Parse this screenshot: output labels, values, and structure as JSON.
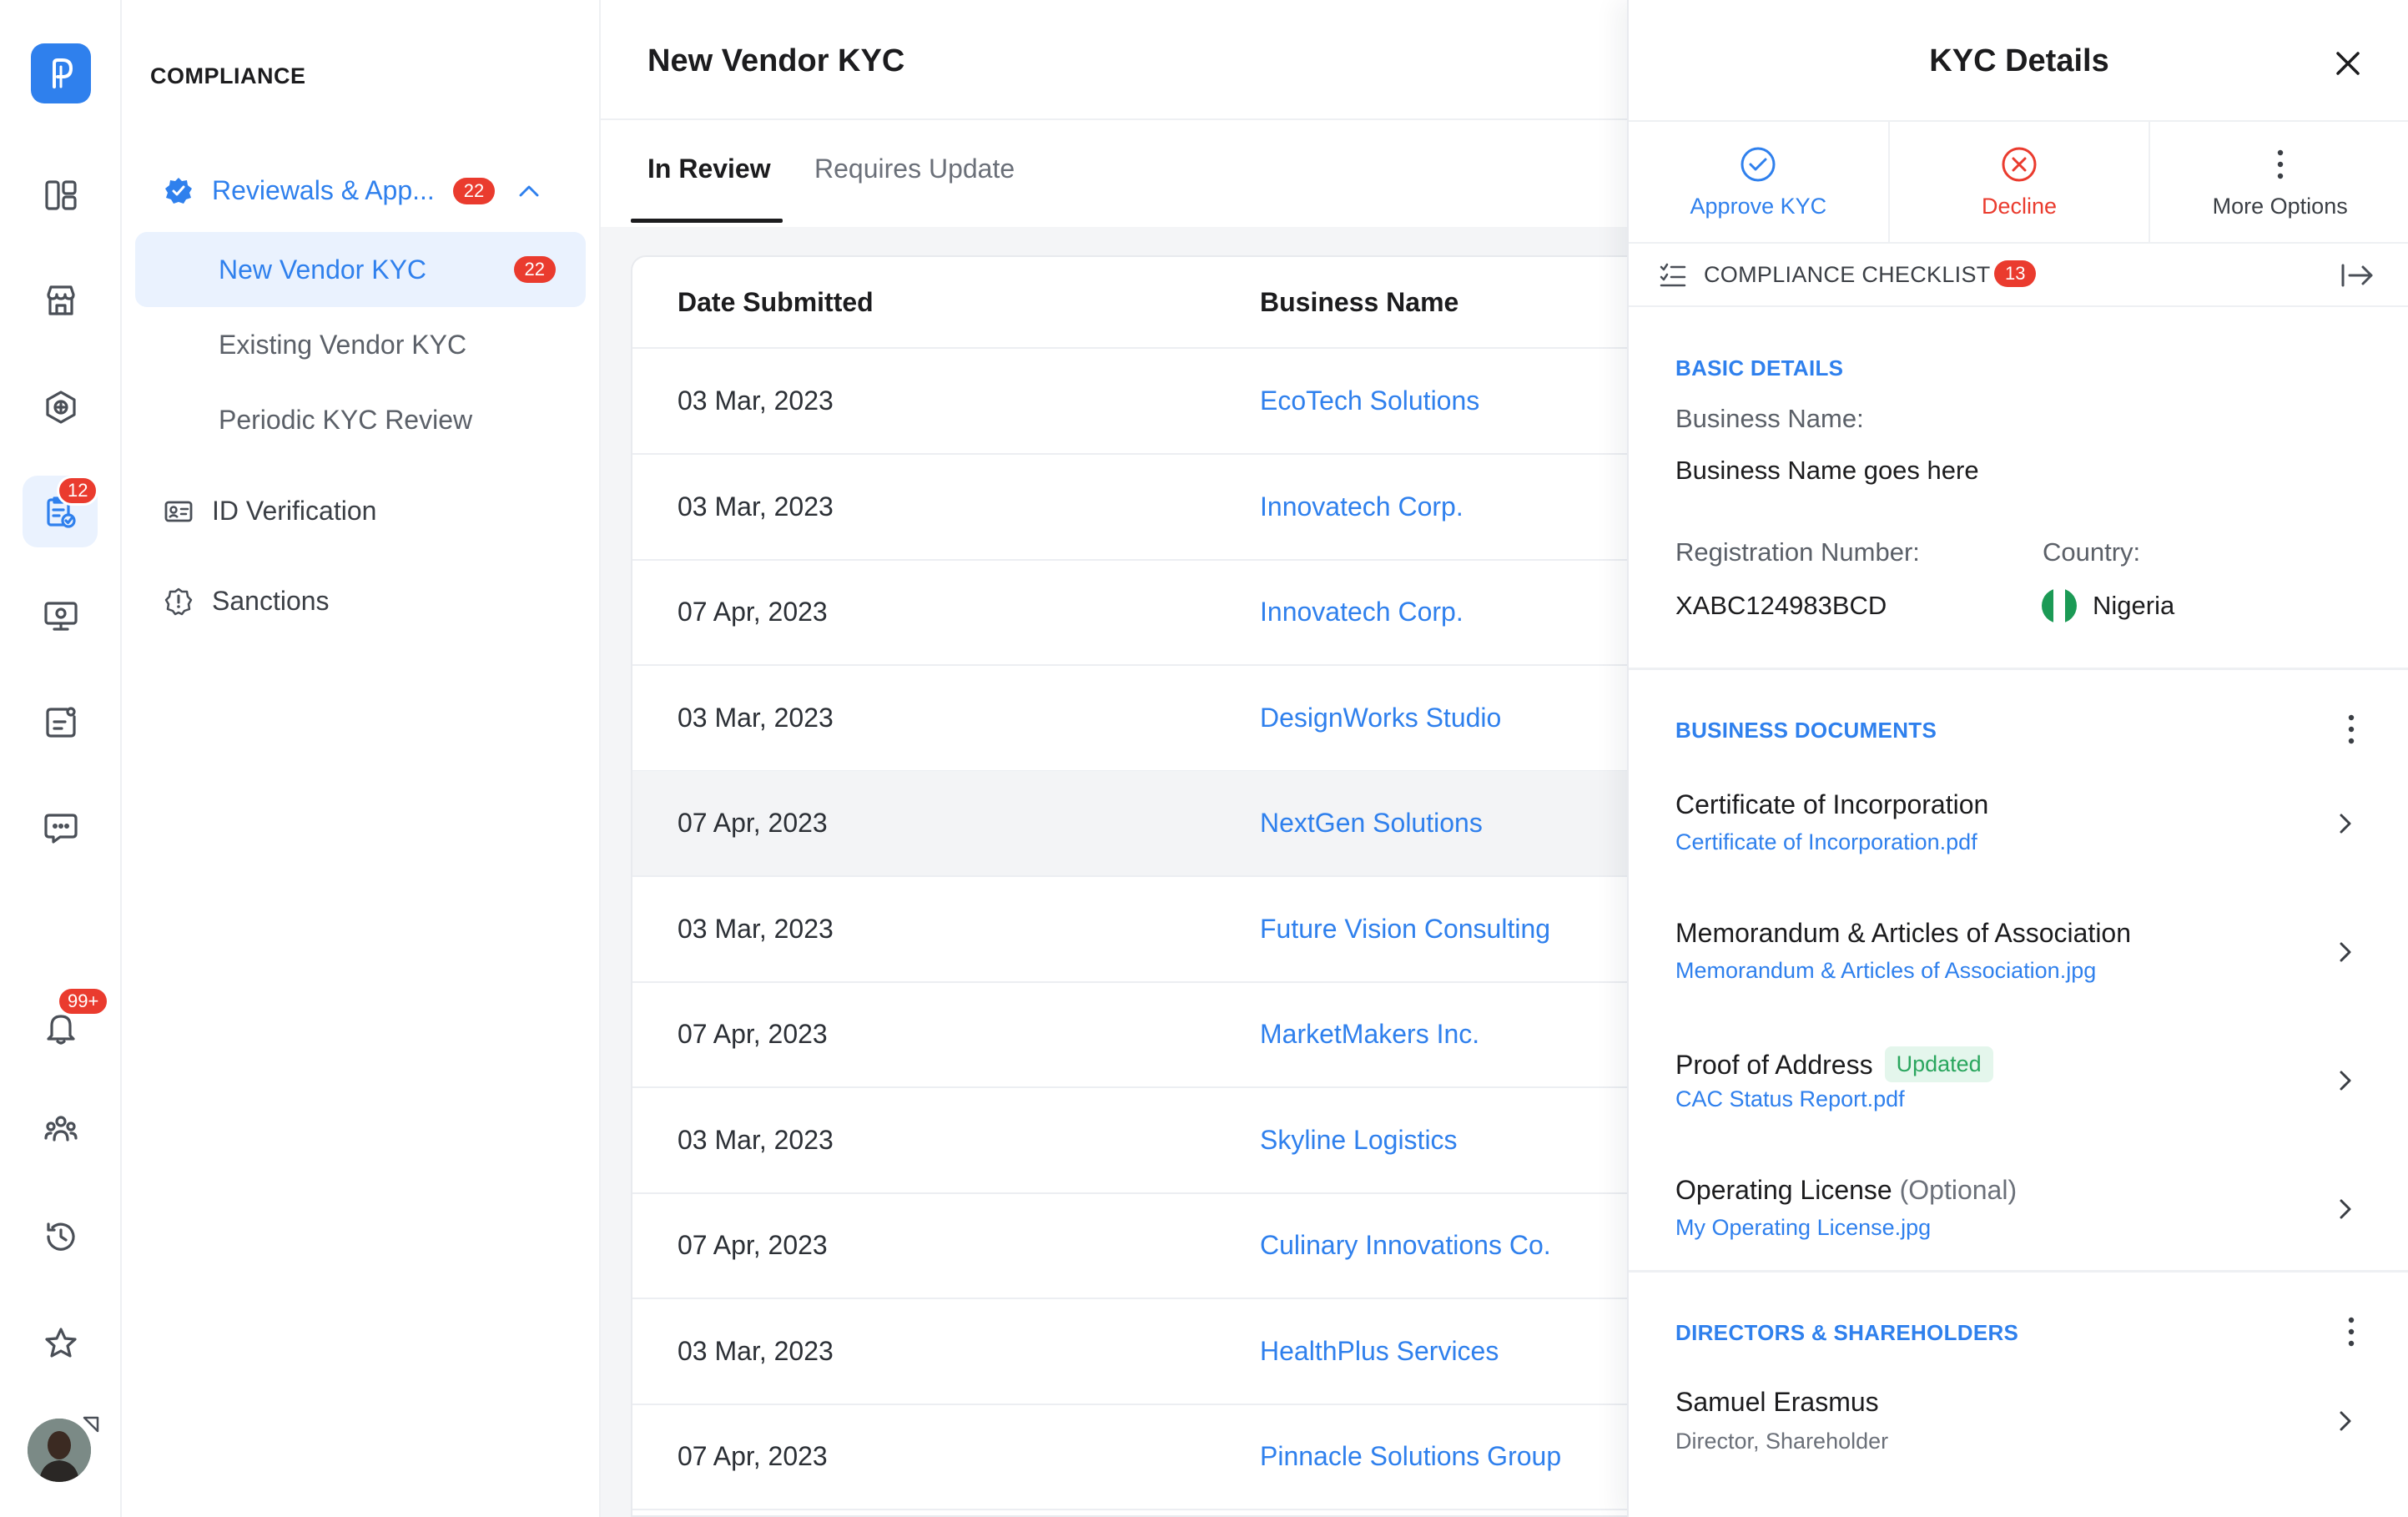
{
  "rail": {
    "logo_letter": "P",
    "clipboard_badge": "12",
    "bell_badge": "99+"
  },
  "subnav": {
    "title": "COMPLIANCE",
    "group_reviewals": {
      "label": "Reviewals & App...",
      "count": "22"
    },
    "items": [
      {
        "label": "New Vendor KYC",
        "count": "22"
      },
      {
        "label": "Existing Vendor KYC"
      },
      {
        "label": "Periodic KYC Review"
      }
    ],
    "group_id": {
      "label": "ID Verification"
    },
    "group_sanctions": {
      "label": "Sanctions"
    }
  },
  "main": {
    "title": "New Vendor KYC",
    "tabs": [
      "In Review",
      "Requires Update"
    ],
    "columns": [
      "Date Submitted",
      "Business Name"
    ],
    "rows": [
      {
        "date": "03 Mar, 2023",
        "name": "EcoTech Solutions"
      },
      {
        "date": "03 Mar, 2023",
        "name": "Innovatech Corp."
      },
      {
        "date": "07 Apr, 2023",
        "name": "Innovatech Corp."
      },
      {
        "date": "03 Mar, 2023",
        "name": "DesignWorks Studio"
      },
      {
        "date": "07 Apr, 2023",
        "name": "NextGen Solutions"
      },
      {
        "date": "03 Mar, 2023",
        "name": "Future Vision Consulting"
      },
      {
        "date": "07 Apr, 2023",
        "name": "MarketMakers Inc."
      },
      {
        "date": "03 Mar, 2023",
        "name": "Skyline Logistics"
      },
      {
        "date": "07 Apr, 2023",
        "name": "Culinary Innovations Co."
      },
      {
        "date": "03 Mar, 2023",
        "name": "HealthPlus Services"
      },
      {
        "date": "07 Apr, 2023",
        "name": "Pinnacle Solutions Group"
      }
    ]
  },
  "panel": {
    "title": "KYC Details",
    "actions": {
      "approve": "Approve KYC",
      "decline": "Decline",
      "more": "More Options"
    },
    "checklist": {
      "label": "COMPLIANCE CHECKLIST",
      "count": "13"
    },
    "basic": {
      "section": "BASIC DETAILS",
      "business_name_label": "Business Name:",
      "business_name_value": "Business Name goes here",
      "reg_label": "Registration Number:",
      "reg_value": "XABC124983BCD",
      "country_label": "Country:",
      "country_value": "Nigeria"
    },
    "documents": {
      "section": "BUSINESS DOCUMENTS",
      "items": [
        {
          "title": "Certificate of Incorporation",
          "file": "Certificate of Incorporation.pdf"
        },
        {
          "title": "Memorandum & Articles of Association",
          "file": "Memorandum & Articles of Association.jpg"
        },
        {
          "title": "Proof of Address",
          "tag": "Updated",
          "file": "CAC Status Report.pdf"
        },
        {
          "title": "Operating License",
          "optional": "(Optional)",
          "file": "My Operating License.jpg"
        }
      ]
    },
    "directors": {
      "section": "DIRECTORS & SHAREHOLDERS",
      "items": [
        {
          "name": "Samuel Erasmus",
          "role": "Director, Shareholder"
        }
      ]
    }
  },
  "colors": {
    "accent": "#2f80ed",
    "danger": "#ea3b2e",
    "success": "#2aa65e",
    "nigeria_green": "#1b9a55"
  }
}
